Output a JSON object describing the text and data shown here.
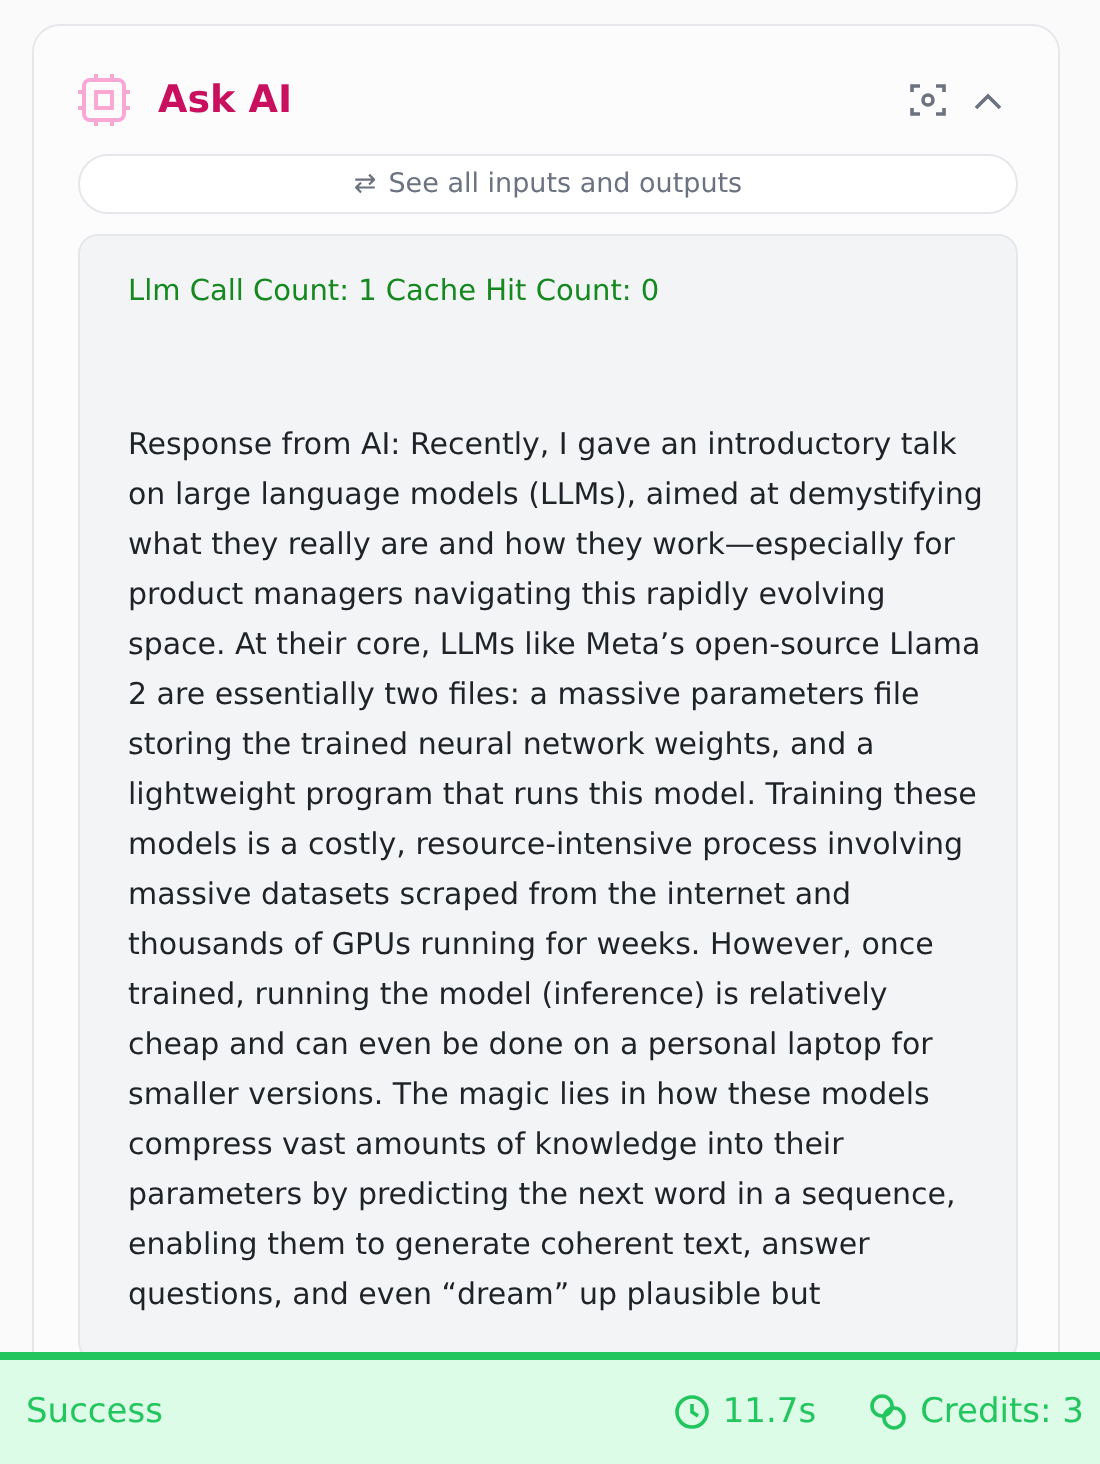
{
  "node": {
    "title": "Ask AI",
    "io_button": {
      "icon": "⇄",
      "label": "See all inputs and outputs"
    },
    "output": {
      "counts": "Llm Call Count: 1 Cache Hit Count: 0",
      "response": "Response from AI: Recently, I gave an introductory talk on large language models (LLMs), aimed at demystifying what they really are and how they work—especially for product managers navigating this rapidly evolving space. At their core, LLMs like Meta’s open-source Llama 2 are essentially two files: a massive parameters file storing the trained neural network weights, and a lightweight program that runs this model. Training these models is a costly, resource-intensive process involving massive datasets scraped from the internet and thousands of GPUs running for weeks. However, once trained, running the model (inference) is relatively cheap and can even be done on a personal laptop for smaller versions. The magic lies in how these models compress vast amounts of knowledge into their parameters by predicting the next word in a sequence, enabling them to generate coherent text, answer questions, and even “dream” up plausible but"
    }
  },
  "status_bar": {
    "status": "Success",
    "duration": "11.7s",
    "credits": "Credits: 3"
  }
}
